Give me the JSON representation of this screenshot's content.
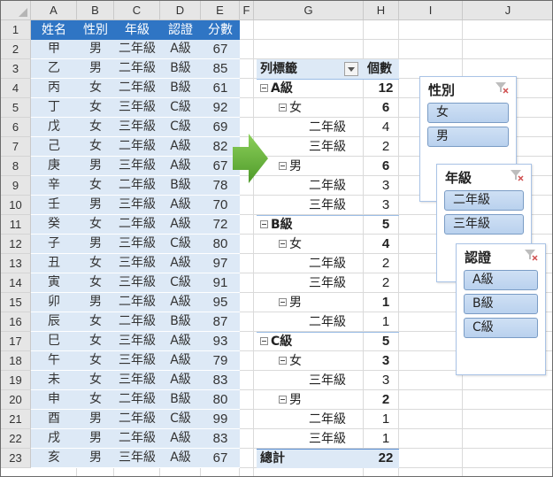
{
  "columns": [
    "A",
    "B",
    "C",
    "D",
    "E",
    "F",
    "G",
    "H",
    "I",
    "J"
  ],
  "rows": [
    "1",
    "2",
    "3",
    "4",
    "5",
    "6",
    "7",
    "8",
    "9",
    "10",
    "11",
    "12",
    "13",
    "14",
    "15",
    "16",
    "17",
    "18",
    "19",
    "20",
    "21",
    "22",
    "23"
  ],
  "table": {
    "headers": [
      "姓名",
      "性別",
      "年級",
      "認證",
      "分數"
    ],
    "rows": [
      [
        "甲",
        "男",
        "二年級",
        "A級",
        "67"
      ],
      [
        "乙",
        "男",
        "二年級",
        "B級",
        "85"
      ],
      [
        "丙",
        "女",
        "二年級",
        "B級",
        "61"
      ],
      [
        "丁",
        "女",
        "三年級",
        "C級",
        "92"
      ],
      [
        "戊",
        "女",
        "三年級",
        "C級",
        "69"
      ],
      [
        "己",
        "女",
        "二年級",
        "A級",
        "82"
      ],
      [
        "庚",
        "男",
        "三年級",
        "A級",
        "67"
      ],
      [
        "辛",
        "女",
        "二年級",
        "B級",
        "78"
      ],
      [
        "壬",
        "男",
        "三年級",
        "A級",
        "70"
      ],
      [
        "癸",
        "女",
        "二年級",
        "A級",
        "72"
      ],
      [
        "子",
        "男",
        "三年級",
        "C級",
        "80"
      ],
      [
        "丑",
        "女",
        "三年級",
        "A級",
        "97"
      ],
      [
        "寅",
        "女",
        "三年級",
        "C級",
        "91"
      ],
      [
        "卯",
        "男",
        "二年級",
        "A級",
        "95"
      ],
      [
        "辰",
        "女",
        "二年級",
        "B級",
        "87"
      ],
      [
        "巳",
        "女",
        "三年級",
        "A級",
        "93"
      ],
      [
        "午",
        "女",
        "三年級",
        "A級",
        "79"
      ],
      [
        "未",
        "女",
        "三年級",
        "A級",
        "83"
      ],
      [
        "申",
        "女",
        "二年級",
        "B級",
        "80"
      ],
      [
        "酉",
        "男",
        "二年級",
        "C級",
        "99"
      ],
      [
        "戌",
        "男",
        "二年級",
        "A級",
        "83"
      ],
      [
        "亥",
        "男",
        "三年級",
        "A級",
        "67"
      ]
    ]
  },
  "pivot": {
    "row_label_header": "列標籤",
    "value_header": "個數",
    "rows": [
      {
        "level": 0,
        "label": "A級",
        "value": "12",
        "collapse": true
      },
      {
        "level": 1,
        "label": "女",
        "value": "6",
        "collapse": true
      },
      {
        "level": 2,
        "label": "二年級",
        "value": "4",
        "collapse": false
      },
      {
        "level": 2,
        "label": "三年級",
        "value": "2",
        "collapse": false
      },
      {
        "level": 1,
        "label": "男",
        "value": "6",
        "collapse": true
      },
      {
        "level": 2,
        "label": "二年級",
        "value": "3",
        "collapse": false
      },
      {
        "level": 2,
        "label": "三年級",
        "value": "3",
        "collapse": false
      },
      {
        "level": 0,
        "label": "B級",
        "value": "5",
        "collapse": true
      },
      {
        "level": 1,
        "label": "女",
        "value": "4",
        "collapse": true
      },
      {
        "level": 2,
        "label": "二年級",
        "value": "2",
        "collapse": false
      },
      {
        "level": 2,
        "label": "三年級",
        "value": "2",
        "collapse": false
      },
      {
        "level": 1,
        "label": "男",
        "value": "1",
        "collapse": true
      },
      {
        "level": 2,
        "label": "二年級",
        "value": "1",
        "collapse": false
      },
      {
        "level": 0,
        "label": "C級",
        "value": "5",
        "collapse": true
      },
      {
        "level": 1,
        "label": "女",
        "value": "3",
        "collapse": true
      },
      {
        "level": 2,
        "label": "三年級",
        "value": "3",
        "collapse": false
      },
      {
        "level": 1,
        "label": "男",
        "value": "2",
        "collapse": true
      },
      {
        "level": 2,
        "label": "二年級",
        "value": "1",
        "collapse": false
      },
      {
        "level": 2,
        "label": "三年級",
        "value": "1",
        "collapse": false
      }
    ],
    "grand_total_label": "總計",
    "grand_total_value": "22"
  },
  "slicers": [
    {
      "title": "性別",
      "items": [
        "女",
        "男"
      ]
    },
    {
      "title": "年級",
      "items": [
        "二年級",
        "三年級"
      ]
    },
    {
      "title": "認證",
      "items": [
        "A級",
        "B級",
        "C級"
      ]
    }
  ],
  "icons": {
    "arrow": "green-right-arrow-icon",
    "filter": "filter-dropdown-icon",
    "clear_filter": "clear-filter-icon",
    "collapse": "collapse-minus-icon"
  },
  "colors": {
    "table_header": "#2f75c4",
    "table_band": "#dde9f6",
    "pivot_header": "#dde9f6",
    "slicer_item": "#c3d8f1",
    "arrow": "#6fb33f"
  }
}
